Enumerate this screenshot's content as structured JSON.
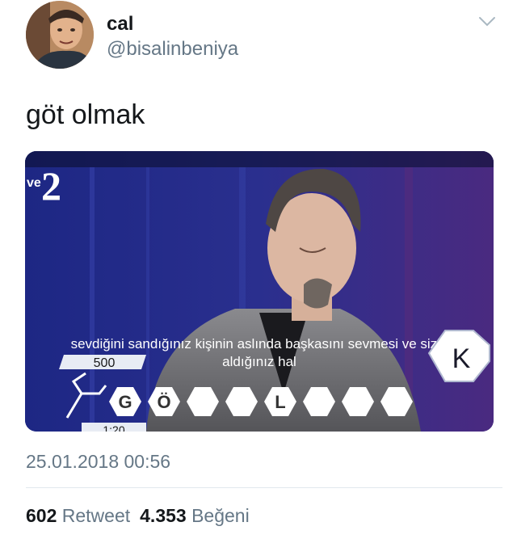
{
  "user": {
    "display_name": "cal",
    "handle": "@bisalinbeniya"
  },
  "tweet": {
    "text": "göt olmak",
    "timestamp": "25.01.2018 00:56"
  },
  "media": {
    "channel_logo_prefix": "ve",
    "channel_logo_number": "2",
    "subtitle_line1": "sevdiğini sandığınız kişinin aslında başkasını sevmesi ve sizin",
    "subtitle_line2": "aldığınız hal",
    "score": "500",
    "letter_k": "K",
    "tiles": [
      "G",
      "Ö",
      "",
      "",
      "L",
      "",
      "",
      ""
    ],
    "timer_partial": "1:20"
  },
  "stats": {
    "retweets": "602",
    "retweets_label": "Retweet",
    "likes": "4.353",
    "likes_label": "Beğeni"
  },
  "colors": {
    "secondary_text": "#657786",
    "primary_text": "#14171a",
    "divider": "#e1e8ed"
  }
}
